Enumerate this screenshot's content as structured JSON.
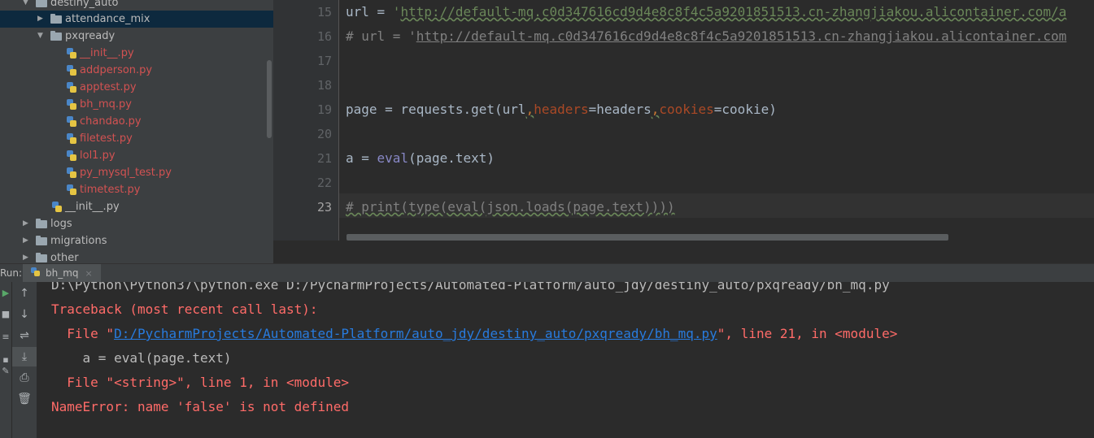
{
  "project_tree": {
    "items": [
      {
        "label": "destiny_auto",
        "kind": "folder",
        "expanded": true
      },
      {
        "label": "attendance_mix",
        "kind": "folder",
        "expanded": false,
        "selected": true
      },
      {
        "label": "pxqready",
        "kind": "folder",
        "expanded": true
      },
      {
        "label": "__init__.py",
        "kind": "py",
        "status": "modified"
      },
      {
        "label": "addperson.py",
        "kind": "py",
        "status": "modified"
      },
      {
        "label": "apptest.py",
        "kind": "py",
        "status": "modified"
      },
      {
        "label": "bh_mq.py",
        "kind": "py",
        "status": "modified"
      },
      {
        "label": "chandao.py",
        "kind": "py",
        "status": "modified"
      },
      {
        "label": "filetest.py",
        "kind": "py",
        "status": "modified"
      },
      {
        "label": "lol1.py",
        "kind": "py",
        "status": "modified"
      },
      {
        "label": "py_mysql_test.py",
        "kind": "py",
        "status": "modified"
      },
      {
        "label": "timetest.py",
        "kind": "py",
        "status": "modified"
      },
      {
        "label": "__init__.py",
        "kind": "py",
        "status": "normal"
      },
      {
        "label": "logs",
        "kind": "folder",
        "expanded": false
      },
      {
        "label": "migrations",
        "kind": "folder",
        "expanded": false
      },
      {
        "label": "other",
        "kind": "folder",
        "expanded": false
      }
    ]
  },
  "editor": {
    "current_line": "23",
    "line_numbers": [
      "15",
      "16",
      "17",
      "18",
      "19",
      "20",
      "21",
      "22",
      "23"
    ],
    "line15": {
      "prefix": "url = ",
      "quote": "'",
      "url": "http://default-mq.c0d347616cd9d4e8c8f4c5a9201851513.cn-zhangjiakou.alicontainer.com/a"
    },
    "line16": {
      "prefix": "# url = '",
      "url": "http://default-mq.c0d347616cd9d4e8c8f4c5a9201851513.cn-zhangjiakou.alicontainer.com"
    },
    "line19": {
      "a": "page = requests.get(url",
      "comma1": ",",
      "kw1": "headers",
      "b": "=headers",
      "comma2": ",",
      "kw2": "cookies",
      "c": "=cookie)"
    },
    "line21": {
      "a": "a = ",
      "fn": "eval",
      "b": "(page.text)"
    },
    "line23": {
      "text": "# print(type(eval(json.loads(page.text))))"
    }
  },
  "run_window": {
    "label": "Run:",
    "tab_label": "bh_mq",
    "tab_close": "×",
    "tools": [
      "up-arrow-icon",
      "down-arrow-icon",
      "soft-wrap-icon",
      "scroll-to-end-icon",
      "print-icon",
      "trash-icon"
    ],
    "console": {
      "command": "D:\\Python\\Python37\\python.exe D:/PycharmProjects/Automated-Platform/auto_jdy/destiny_auto/pxqready/bh_mq.py",
      "traceback": "Traceback (most recent call last):",
      "file1_prefix": "  File \"",
      "file1_path": "D:/PycharmProjects/Automated-Platform/auto_jdy/destiny_auto/pxqready/bh_mq.py",
      "file1_suffix": "\", line 21, in <module>",
      "code_line": "    a = eval(page.text)",
      "file2": "  File \"<string>\", line 1, in <module>",
      "error": "NameError: name 'false' is not defined"
    }
  },
  "colors": {
    "modified_file": "#d25252",
    "error_text": "#ff6b68",
    "link": "#287bde",
    "keyword": "#cc7832",
    "param": "#aa4926"
  }
}
